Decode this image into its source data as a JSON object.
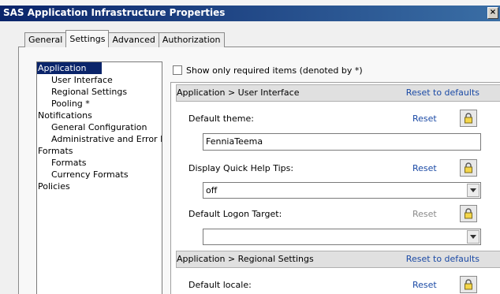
{
  "window": {
    "title": "SAS Application Infrastructure Properties"
  },
  "tabs": [
    {
      "label": "General",
      "active": false
    },
    {
      "label": "Settings",
      "active": true
    },
    {
      "label": "Advanced",
      "active": false
    },
    {
      "label": "Authorization",
      "active": false
    }
  ],
  "tree": {
    "items": [
      {
        "label": "Application",
        "level": 0,
        "selected": true
      },
      {
        "label": "User Interface",
        "level": 1
      },
      {
        "label": "Regional Settings",
        "level": 1
      },
      {
        "label": "Pooling *",
        "level": 1
      },
      {
        "label": "Notifications",
        "level": 0
      },
      {
        "label": "General Configuration",
        "level": 1
      },
      {
        "label": "Administrative and Error Me",
        "level": 1
      },
      {
        "label": "Formats",
        "level": 0
      },
      {
        "label": "Formats",
        "level": 1
      },
      {
        "label": "Currency Formats",
        "level": 1
      },
      {
        "label": "Policies",
        "level": 0
      }
    ]
  },
  "options": {
    "show_required_label": "Show only required items (denoted by *)",
    "show_required_checked": false
  },
  "sections": {
    "user_interface": {
      "header": "Application > User Interface",
      "reset_defaults": "Reset to defaults",
      "default_theme": {
        "label": "Default theme:",
        "reset": "Reset",
        "value": "FenniaTeema"
      },
      "quick_help": {
        "label": "Display Quick Help Tips:",
        "reset": "Reset",
        "value": "off"
      },
      "logon_target": {
        "label": "Default Logon Target:",
        "reset": "Reset",
        "value": ""
      }
    },
    "regional": {
      "header": "Application > Regional Settings",
      "reset_defaults": "Reset to defaults",
      "default_locale": {
        "label": "Default locale:",
        "reset": "Reset"
      }
    }
  },
  "icons": {
    "close": "close-icon",
    "lock": "lock-icon",
    "dropdown": "chevron-down-icon"
  },
  "colors": {
    "titlebar": "#0a246a",
    "link": "#1b4aa5",
    "selection": "#0a246a"
  }
}
